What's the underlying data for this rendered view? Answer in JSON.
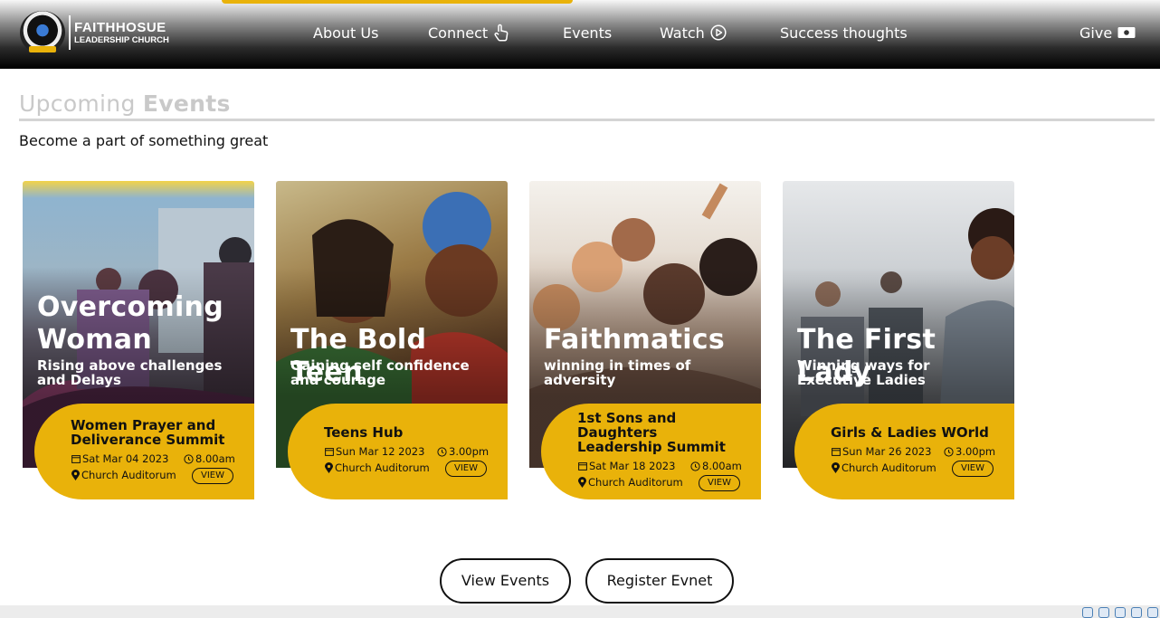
{
  "header": {
    "logo_line1": "FAITHHOSUE",
    "logo_line2": "LEADERSHIP CHURCH",
    "nav": [
      {
        "label": "About Us"
      },
      {
        "label": "Connect",
        "icon": "hand-pointer-icon"
      },
      {
        "label": "Events"
      },
      {
        "label": "Watch",
        "icon": "play-circle-icon"
      },
      {
        "label": "Success thoughts"
      },
      {
        "label": "Give",
        "icon": "money-bill-icon"
      }
    ]
  },
  "section": {
    "title_light": "Upcoming",
    "title_bold": "Events",
    "subtitle": "Become a part of something great"
  },
  "events": [
    {
      "headline_1": "Overcoming",
      "headline_2": "Woman",
      "tagline_1": "Rising above challenges",
      "tagline_2": "and Delays",
      "title_1": "Women Prayer and",
      "title_2": "Deliverance Summit",
      "title_3": "",
      "date": "Sat Mar 04 2023",
      "time": "8.00am",
      "venue": "Church Auditorum",
      "view_label": "VIEW"
    },
    {
      "headline_1": "The Bold Teen",
      "headline_2": "",
      "tagline_1": "Gaining self confidence",
      "tagline_2": "and courage",
      "title_1": "Teens Hub",
      "title_2": "",
      "title_3": "",
      "date": "Sun Mar 12 2023",
      "time": "3.00pm",
      "venue": "Church Auditorum",
      "view_label": "VIEW"
    },
    {
      "headline_1": "Faithmatics",
      "headline_2": "",
      "tagline_1": "winning in times of",
      "tagline_2": "adversity",
      "title_1": "1st Sons and",
      "title_2": "Daughters",
      "title_3": "Leadership Summit",
      "date": "Sat Mar 18 2023",
      "time": "8.00am",
      "venue": "Church Auditorum",
      "view_label": "VIEW"
    },
    {
      "headline_1": "The First Lady",
      "headline_2": "",
      "tagline_1": "Winning ways for",
      "tagline_2": "Executive Ladies",
      "title_1": "Girls & Ladies WOrld",
      "title_2": "",
      "title_3": "",
      "date": "Sun Mar 26 2023",
      "time": "3.00pm",
      "venue": "Church Auditorum",
      "view_label": "VIEW"
    }
  ],
  "buttons": {
    "view_events": "View Events",
    "register_event": "Register Evnet"
  },
  "colors": {
    "accent": "#e9b20a",
    "title_gray": "#c9c9c9"
  }
}
